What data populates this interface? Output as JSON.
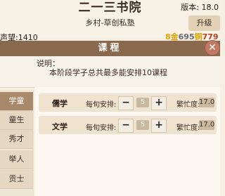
{
  "header": {
    "title": "二一三书院",
    "version": "版本: 18.0",
    "subtitle": "乡村-草创私塾",
    "upgrade_label": "升级",
    "reputation": "声望:1410",
    "res_prefix": "8金",
    "res_value1": "695",
    "res_unit": "铜",
    "res_value2": "779铜"
  },
  "panel": {
    "title": "课程",
    "close_icon": "close-icon",
    "desc_label": "说明：",
    "desc_text": "本阶段学子总共最多能安排10课程"
  },
  "sidebar": {
    "items": [
      {
        "label": "学童",
        "active": true
      },
      {
        "label": "童生",
        "active": false
      },
      {
        "label": "秀才",
        "active": false
      },
      {
        "label": "举人",
        "active": false
      },
      {
        "label": "贡士",
        "active": false
      }
    ]
  },
  "courses": [
    {
      "name": "儒学",
      "schedule_label": "每旬安排:",
      "count": "5",
      "busy_label": "繁忙度:",
      "busy": "17.0"
    },
    {
      "name": "文学",
      "schedule_label": "每旬安排:",
      "count": "5",
      "busy_label": "繁忙度:",
      "busy": "17.0"
    }
  ],
  "controls": {
    "minus": "−",
    "plus": "+"
  }
}
